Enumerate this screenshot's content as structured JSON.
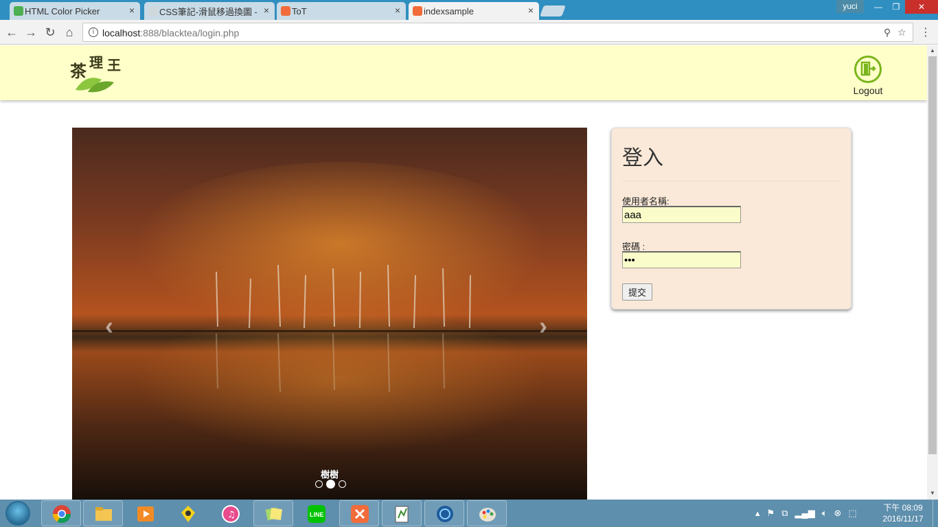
{
  "browser": {
    "tabs": [
      {
        "title": "HTML Color Picker",
        "icon_color": "#4caf50",
        "active": false
      },
      {
        "title": "CSS筆記-滑鼠移過換圖 -",
        "icon_color": "#cfd8dc",
        "active": false
      },
      {
        "title": "ToT",
        "icon_color": "#f26b3a",
        "active": false
      },
      {
        "title": "indexsample",
        "icon_color": "#f26b3a",
        "active": true
      }
    ],
    "close_glyph": "×",
    "user": "yuci",
    "url_host": "localhost",
    "url_path": ":888/blacktea/login.php"
  },
  "header": {
    "logo_text": "茶理王",
    "logout_label": "Logout",
    "accent": "#7ab51d",
    "background": "#ffffc9"
  },
  "carousel": {
    "caption": "樹樹",
    "slide_count": 3,
    "active_index": 1,
    "prev_glyph": "‹",
    "next_glyph": "›"
  },
  "login": {
    "title": "登入",
    "username_label": "使用者名稱:",
    "username_value": "aaa",
    "password_label": "密碼 :",
    "password_value": "aaa",
    "submit_label": "提交",
    "background": "#fae9d8",
    "input_background": "#fafdc9"
  },
  "taskbar": {
    "clock_period_time": "下午 08:09",
    "clock_date": "2016/11/17",
    "apps": [
      "chrome-icon",
      "file-explorer-icon",
      "media-player-icon",
      "kakao-icon",
      "itunes-icon",
      "sticky-notes-icon",
      "line-icon",
      "xampp-icon",
      "notepad-plus-icon",
      "browser-globe-icon",
      "paint-icon"
    ]
  }
}
